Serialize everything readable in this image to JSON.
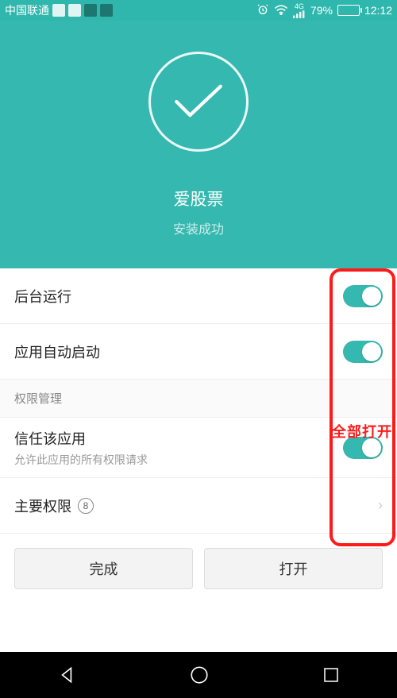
{
  "status": {
    "carrier": "中国联通",
    "network_label": "4G",
    "battery_pct": "79%",
    "time": "12:12"
  },
  "hero": {
    "app_name": "爱股票",
    "install_status": "安装成功"
  },
  "rows": {
    "bg_run": "后台运行",
    "auto_start": "应用自动启动",
    "perm_mgmt": "权限管理",
    "trust_app": "信任该应用",
    "trust_app_sub": "允许此应用的所有权限请求",
    "main_perm": "主要权限",
    "main_perm_count": "8"
  },
  "annotation": {
    "all_on": "全部打开"
  },
  "buttons": {
    "done": "完成",
    "open": "打开"
  }
}
